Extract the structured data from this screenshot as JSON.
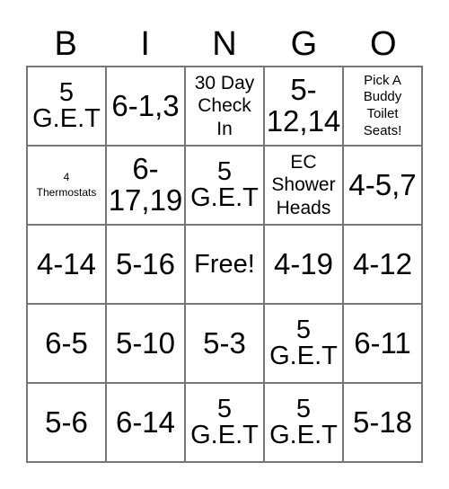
{
  "header": [
    "B",
    "I",
    "N",
    "G",
    "O"
  ],
  "cells": [
    [
      "5\nG.E.T",
      "6-1,3",
      "30 Day\nCheck\nIn",
      "5-\n12,14",
      "Pick A\nBuddy\nToilet\nSeats!"
    ],
    [
      "4\nThermostats",
      "6-\n17,19",
      "5\nG.E.T",
      "EC\nShower\nHeads",
      "4-5,7"
    ],
    [
      "4-14",
      "5-16",
      "Free!",
      "4-19",
      "4-12"
    ],
    [
      "6-5",
      "5-10",
      "5-3",
      "5\nG.E.T",
      "6-11"
    ],
    [
      "5-6",
      "6-14",
      "5\nG.E.T",
      "5\nG.E.T",
      "5-18"
    ]
  ]
}
